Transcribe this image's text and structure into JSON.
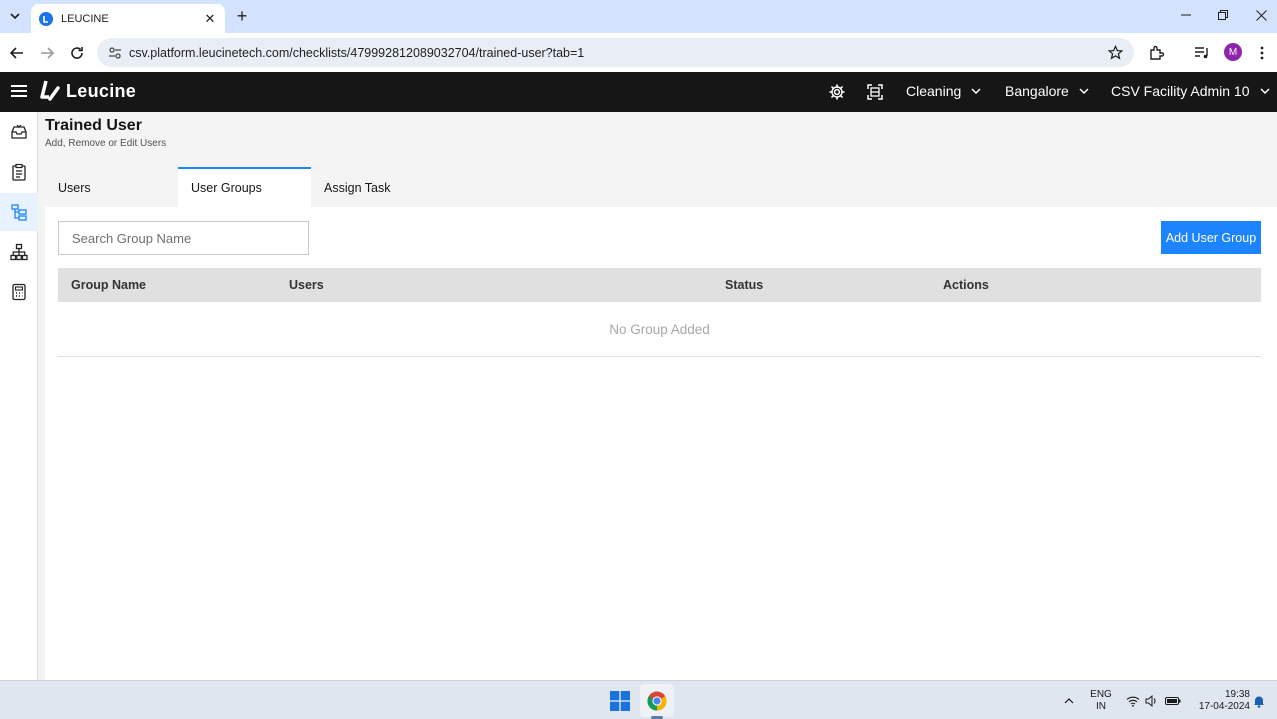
{
  "browser": {
    "tab_title": "LEUCINE",
    "url": "csv.platform.leucinetech.com/checklists/479992812089032704/trained-user?tab=1",
    "profile_initial": "M"
  },
  "header": {
    "brand": "Leucine",
    "use_case": "Cleaning",
    "facility": "Bangalore",
    "user": "CSV Facility Admin 10"
  },
  "page": {
    "title": "Trained User",
    "subtitle": "Add, Remove or Edit Users",
    "tabs": [
      "Users",
      "User Groups",
      "Assign Task"
    ],
    "active_tab": "User Groups"
  },
  "toolbar": {
    "search_placeholder": "Search Group Name",
    "add_label": "Add User Group"
  },
  "table": {
    "columns": [
      "Group Name",
      "Users",
      "Status",
      "Actions"
    ],
    "empty_text": "No Group Added"
  },
  "taskbar": {
    "lang_top": "ENG",
    "lang_bottom": "IN",
    "time": "19:38",
    "date": "17-04-2024"
  },
  "colors": {
    "accent": "#1d84ff",
    "header_bg": "#161616"
  }
}
